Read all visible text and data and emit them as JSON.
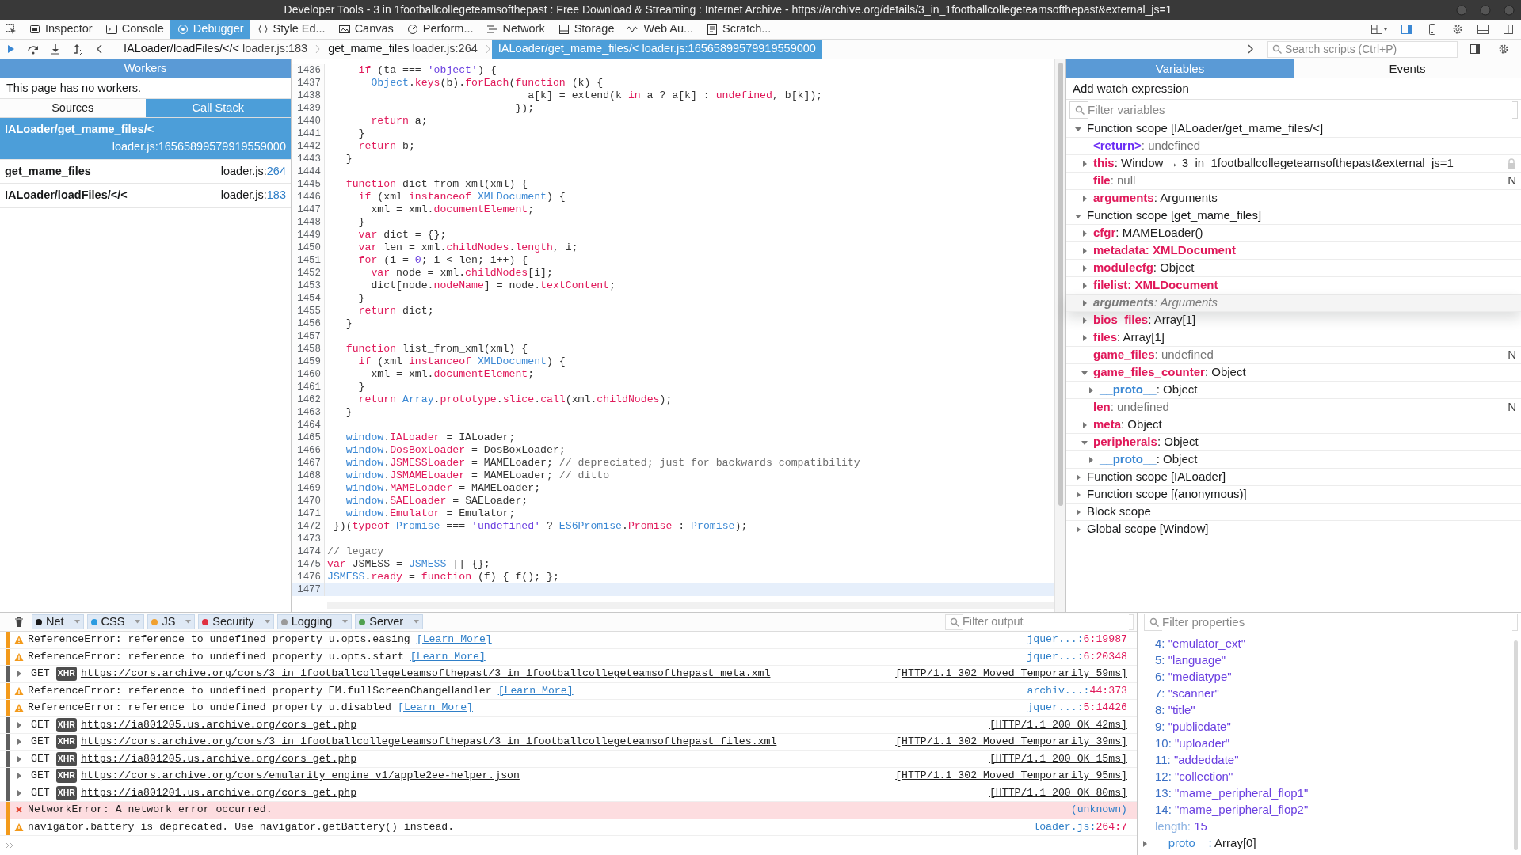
{
  "window": {
    "title": "Developer Tools - 3 in 1footballcollegeteamsofthepast : Free Download & Streaming : Internet Archive - https://archive.org/details/3_in_1footballcollegeteamsofthepast&external_js=1"
  },
  "tabs": [
    {
      "label": "Inspector",
      "selected": false
    },
    {
      "label": "Console",
      "selected": false
    },
    {
      "label": "Debugger",
      "selected": true
    },
    {
      "label": "Style Ed...",
      "selected": false
    },
    {
      "label": "Canvas",
      "selected": false
    },
    {
      "label": "Perform...",
      "selected": false
    },
    {
      "label": "Network",
      "selected": false
    },
    {
      "label": "Storage",
      "selected": false
    },
    {
      "label": "Web Au...",
      "selected": false
    },
    {
      "label": "Scratch...",
      "selected": false
    }
  ],
  "breadcrumbs": [
    {
      "function": "IALoader/loadFiles/</<",
      "location": "loader.js:183",
      "selected": false
    },
    {
      "function": "get_mame_files",
      "location": "loader.js:264",
      "selected": false
    },
    {
      "function": "IALoader/get_mame_files/<",
      "location": "loader.js:16565899579919559000",
      "selected": true
    }
  ],
  "search": {
    "placeholder": "Search scripts (Ctrl+P)"
  },
  "left_panel": {
    "header": "Workers",
    "message": "This page has no workers.",
    "tabs": [
      {
        "label": "Sources",
        "selected": false
      },
      {
        "label": "Call Stack",
        "selected": true
      }
    ],
    "call_stack": [
      {
        "function": "IALoader/get_mame_files/<",
        "file": "loader.js:",
        "line": "16565899579919559000",
        "selected": true
      },
      {
        "function": "get_mame_files",
        "file": "loader.js:",
        "line": "264",
        "selected": false
      },
      {
        "function": "IALoader/loadFiles/</<",
        "file": "loader.js:",
        "line": "183",
        "selected": false
      }
    ]
  },
  "code": [
    {
      "number": "1436",
      "current": false,
      "tokens": [
        {
          "kind": "keyword",
          "text": "     if"
        },
        {
          "kind": "plain",
          "text": " (ta === "
        },
        {
          "kind": "string",
          "text": "'object'"
        },
        {
          "kind": "plain",
          "text": ") {"
        }
      ]
    },
    {
      "number": "1437",
      "current": false,
      "tokens": [
        {
          "kind": "global",
          "text": "       Object"
        },
        {
          "kind": "plain",
          "text": "."
        },
        {
          "kind": "property",
          "text": "keys"
        },
        {
          "kind": "plain",
          "text": "(b)."
        },
        {
          "kind": "property",
          "text": "forEach"
        },
        {
          "kind": "plain",
          "text": "("
        },
        {
          "kind": "keyword",
          "text": "function"
        },
        {
          "kind": "plain",
          "text": " (k) {"
        }
      ]
    },
    {
      "number": "1438",
      "current": false,
      "tokens": [
        {
          "kind": "plain",
          "text": "                                a[k] = extend(k "
        },
        {
          "kind": "keyword",
          "text": "in"
        },
        {
          "kind": "plain",
          "text": " a ? a[k] : "
        },
        {
          "kind": "keyword",
          "text": "undefined"
        },
        {
          "kind": "plain",
          "text": ", b[k]);"
        }
      ]
    },
    {
      "number": "1439",
      "current": false,
      "tokens": [
        {
          "kind": "plain",
          "text": "                              });"
        }
      ]
    },
    {
      "number": "1440",
      "current": false,
      "tokens": [
        {
          "kind": "keyword",
          "text": "       return"
        },
        {
          "kind": "plain",
          "text": " a;"
        }
      ]
    },
    {
      "number": "1441",
      "current": false,
      "tokens": [
        {
          "kind": "plain",
          "text": "     }"
        }
      ]
    },
    {
      "number": "1442",
      "current": false,
      "tokens": [
        {
          "kind": "keyword",
          "text": "     return"
        },
        {
          "kind": "plain",
          "text": " b;"
        }
      ]
    },
    {
      "number": "1443",
      "current": false,
      "tokens": [
        {
          "kind": "plain",
          "text": "   }"
        }
      ]
    },
    {
      "number": "1444",
      "current": false
    },
    {
      "number": "1445",
      "current": false,
      "tokens": [
        {
          "kind": "keyword",
          "text": "   function"
        },
        {
          "kind": "plain",
          "text": " dict_from_xml(xml) {"
        }
      ]
    },
    {
      "number": "1446",
      "current": false,
      "tokens": [
        {
          "kind": "keyword",
          "text": "     if"
        },
        {
          "kind": "plain",
          "text": " (xml "
        },
        {
          "kind": "keyword",
          "text": "instanceof"
        },
        {
          "kind": "global",
          "text": " XMLDocument"
        },
        {
          "kind": "plain",
          "text": ") {"
        }
      ]
    },
    {
      "number": "1447",
      "current": false,
      "tokens": [
        {
          "kind": "plain",
          "text": "       xml = xml."
        },
        {
          "kind": "property",
          "text": "documentElement"
        },
        {
          "kind": "plain",
          "text": ";"
        }
      ]
    },
    {
      "number": "1448",
      "current": false,
      "tokens": [
        {
          "kind": "plain",
          "text": "     }"
        }
      ]
    },
    {
      "number": "1449",
      "current": false,
      "tokens": [
        {
          "kind": "keyword",
          "text": "     var"
        },
        {
          "kind": "plain",
          "text": " dict = {};"
        }
      ]
    },
    {
      "number": "1450",
      "current": false,
      "tokens": [
        {
          "kind": "keyword",
          "text": "     var"
        },
        {
          "kind": "plain",
          "text": " len = xml."
        },
        {
          "kind": "property",
          "text": "childNodes"
        },
        {
          "kind": "plain",
          "text": "."
        },
        {
          "kind": "property",
          "text": "length"
        },
        {
          "kind": "plain",
          "text": ", i;"
        }
      ]
    },
    {
      "number": "1451",
      "current": false,
      "tokens": [
        {
          "kind": "keyword",
          "text": "     for"
        },
        {
          "kind": "plain",
          "text": " (i = "
        },
        {
          "kind": "number",
          "text": "0"
        },
        {
          "kind": "plain",
          "text": "; i < len; i++) {"
        }
      ]
    },
    {
      "number": "1452",
      "current": false,
      "tokens": [
        {
          "kind": "keyword",
          "text": "       var"
        },
        {
          "kind": "plain",
          "text": " node = xml."
        },
        {
          "kind": "property",
          "text": "childNodes"
        },
        {
          "kind": "plain",
          "text": "[i];"
        }
      ]
    },
    {
      "number": "1453",
      "current": false,
      "tokens": [
        {
          "kind": "plain",
          "text": "       dict[node."
        },
        {
          "kind": "property",
          "text": "nodeName"
        },
        {
          "kind": "plain",
          "text": "] = node."
        },
        {
          "kind": "property",
          "text": "textContent"
        },
        {
          "kind": "plain",
          "text": ";"
        }
      ]
    },
    {
      "number": "1454",
      "current": false,
      "tokens": [
        {
          "kind": "plain",
          "text": "     }"
        }
      ]
    },
    {
      "number": "1455",
      "current": false,
      "tokens": [
        {
          "kind": "keyword",
          "text": "     return"
        },
        {
          "kind": "plain",
          "text": " dict;"
        }
      ]
    },
    {
      "number": "1456",
      "current": false,
      "tokens": [
        {
          "kind": "plain",
          "text": "   }"
        }
      ]
    },
    {
      "number": "1457",
      "current": false
    },
    {
      "number": "1458",
      "current": false,
      "tokens": [
        {
          "kind": "keyword",
          "text": "   function"
        },
        {
          "kind": "plain",
          "text": " list_from_xml(xml) {"
        }
      ]
    },
    {
      "number": "1459",
      "current": false,
      "tokens": [
        {
          "kind": "keyword",
          "text": "     if"
        },
        {
          "kind": "plain",
          "text": " (xml "
        },
        {
          "kind": "keyword",
          "text": "instanceof"
        },
        {
          "kind": "global",
          "text": " XMLDocument"
        },
        {
          "kind": "plain",
          "text": ") {"
        }
      ]
    },
    {
      "number": "1460",
      "current": false,
      "tokens": [
        {
          "kind": "plain",
          "text": "       xml = xml."
        },
        {
          "kind": "property",
          "text": "documentElement"
        },
        {
          "kind": "plain",
          "text": ";"
        }
      ]
    },
    {
      "number": "1461",
      "current": false,
      "tokens": [
        {
          "kind": "plain",
          "text": "     }"
        }
      ]
    },
    {
      "number": "1462",
      "current": false,
      "tokens": [
        {
          "kind": "keyword",
          "text": "     return"
        },
        {
          "kind": "global",
          "text": " Array"
        },
        {
          "kind": "plain",
          "text": "."
        },
        {
          "kind": "property",
          "text": "prototype"
        },
        {
          "kind": "plain",
          "text": "."
        },
        {
          "kind": "property",
          "text": "slice"
        },
        {
          "kind": "plain",
          "text": "."
        },
        {
          "kind": "property",
          "text": "call"
        },
        {
          "kind": "plain",
          "text": "(xml."
        },
        {
          "kind": "property",
          "text": "childNodes"
        },
        {
          "kind": "plain",
          "text": ");"
        }
      ]
    },
    {
      "number": "1463",
      "current": false,
      "tokens": [
        {
          "kind": "plain",
          "text": "   }"
        }
      ]
    },
    {
      "number": "1464",
      "current": false
    },
    {
      "number": "1465",
      "current": false,
      "tokens": [
        {
          "kind": "global",
          "text": "   window"
        },
        {
          "kind": "plain",
          "text": "."
        },
        {
          "kind": "property",
          "text": "IALoader"
        },
        {
          "kind": "plain",
          "text": " = IALoader;"
        }
      ]
    },
    {
      "number": "1466",
      "current": false,
      "tokens": [
        {
          "kind": "global",
          "text": "   window"
        },
        {
          "kind": "plain",
          "text": "."
        },
        {
          "kind": "property",
          "text": "DosBoxLoader"
        },
        {
          "kind": "plain",
          "text": " = DosBoxLoader;"
        }
      ]
    },
    {
      "number": "1467",
      "current": false,
      "tokens": [
        {
          "kind": "global",
          "text": "   window"
        },
        {
          "kind": "plain",
          "text": "."
        },
        {
          "kind": "property",
          "text": "JSMESSLoader"
        },
        {
          "kind": "plain",
          "text": " = MAMELoader; "
        },
        {
          "kind": "comment",
          "text": "// depreciated; just for backwards compatibility"
        }
      ]
    },
    {
      "number": "1468",
      "current": false,
      "tokens": [
        {
          "kind": "global",
          "text": "   window"
        },
        {
          "kind": "plain",
          "text": "."
        },
        {
          "kind": "property",
          "text": "JSMAMELoader"
        },
        {
          "kind": "plain",
          "text": " = MAMELoader; "
        },
        {
          "kind": "comment",
          "text": "// ditto"
        }
      ]
    },
    {
      "number": "1469",
      "current": false,
      "tokens": [
        {
          "kind": "global",
          "text": "   window"
        },
        {
          "kind": "plain",
          "text": "."
        },
        {
          "kind": "property",
          "text": "MAMELoader"
        },
        {
          "kind": "plain",
          "text": " = MAMELoader;"
        }
      ]
    },
    {
      "number": "1470",
      "current": false,
      "tokens": [
        {
          "kind": "global",
          "text": "   window"
        },
        {
          "kind": "plain",
          "text": "."
        },
        {
          "kind": "property",
          "text": "SAELoader"
        },
        {
          "kind": "plain",
          "text": " = SAELoader;"
        }
      ]
    },
    {
      "number": "1471",
      "current": false,
      "tokens": [
        {
          "kind": "global",
          "text": "   window"
        },
        {
          "kind": "plain",
          "text": "."
        },
        {
          "kind": "property",
          "text": "Emulator"
        },
        {
          "kind": "plain",
          "text": " = Emulator;"
        }
      ]
    },
    {
      "number": "1472",
      "current": false,
      "tokens": [
        {
          "kind": "plain",
          "text": " })("
        },
        {
          "kind": "keyword",
          "text": "typeof"
        },
        {
          "kind": "global",
          "text": " Promise"
        },
        {
          "kind": "plain",
          "text": " === "
        },
        {
          "kind": "string",
          "text": "'undefined'"
        },
        {
          "kind": "plain",
          "text": " ? "
        },
        {
          "kind": "global",
          "text": "ES6Promise"
        },
        {
          "kind": "plain",
          "text": "."
        },
        {
          "kind": "property",
          "text": "Promise"
        },
        {
          "kind": "plain",
          "text": " : "
        },
        {
          "kind": "global",
          "text": "Promise"
        },
        {
          "kind": "plain",
          "text": ");"
        }
      ]
    },
    {
      "number": "1473",
      "current": false
    },
    {
      "number": "1474",
      "current": false,
      "tokens": [
        {
          "kind": "comment",
          "text": "// legacy"
        }
      ]
    },
    {
      "number": "1475",
      "current": false,
      "tokens": [
        {
          "kind": "keyword",
          "text": "var"
        },
        {
          "kind": "plain",
          "text": " JSMESS = "
        },
        {
          "kind": "global",
          "text": "JSMESS"
        },
        {
          "kind": "plain",
          "text": " || {};"
        }
      ]
    },
    {
      "number": "1476",
      "current": false,
      "tokens": [
        {
          "kind": "global",
          "text": "JSMESS"
        },
        {
          "kind": "plain",
          "text": "."
        },
        {
          "kind": "property",
          "text": "ready"
        },
        {
          "kind": "plain",
          "text": " = "
        },
        {
          "kind": "keyword",
          "text": "function"
        },
        {
          "kind": "plain",
          "text": " (f) { f(); };"
        }
      ]
    },
    {
      "number": "1477",
      "current": true
    }
  ],
  "variables": {
    "tabs": [
      {
        "label": "Variables",
        "selected": true
      },
      {
        "label": "Events",
        "selected": false
      }
    ],
    "watch_label": "Add watch expression",
    "filter_placeholder": "Filter variables",
    "scopes": [
      {
        "label": "Function scope [IALoader/get_mame_files/<]",
        "expanded": true,
        "children": [
          {
            "name": "<return>",
            "value": ": undefined",
            "color": "#6b2cf5",
            "kind": "void",
            "twisty": false,
            "locked": false,
            "shadowed": false
          },
          {
            "name": "this",
            "value": ": Window → 3_in_1footballcollegeteamsofthepast&external_js=1",
            "color": "#e0195a",
            "kind": "text",
            "twisty": true,
            "expanded": false,
            "locked": true,
            "shadowed": false
          },
          {
            "name": "file",
            "value": ": null",
            "color": "#e0195a",
            "kind": "void",
            "twisty": false,
            "locked": false,
            "shadowed": false,
            "flag": "N"
          },
          {
            "name": "arguments",
            "value": ": Arguments",
            "color": "#e0195a",
            "kind": "text",
            "twisty": true,
            "expanded": false,
            "locked": false,
            "shadowed": false
          }
        ]
      },
      {
        "label": "Function scope [get_mame_files]",
        "expanded": true,
        "children": [
          {
            "name": "cfgr",
            "value": ": MAMELoader()",
            "color": "#e0195a",
            "kind": "text",
            "twisty": true,
            "expanded": false,
            "locked": false,
            "shadowed": false
          },
          {
            "name": "metadata",
            "value": ": XMLDocument",
            "color": "#e0195a",
            "kind": "highlight",
            "twisty": true,
            "expanded": false,
            "locked": false,
            "shadowed": false
          },
          {
            "name": "modulecfg",
            "value": ": Object",
            "color": "#e0195a",
            "kind": "text",
            "twisty": true,
            "expanded": false,
            "locked": false,
            "shadowed": false
          },
          {
            "name": "filelist",
            "value": ": XMLDocument",
            "color": "#e0195a",
            "kind": "highlight",
            "twisty": true,
            "expanded": false,
            "locked": false,
            "shadowed": false
          },
          {
            "name": "arguments",
            "value": ": Arguments",
            "color": "#7a7a7a",
            "kind": "text",
            "twisty": true,
            "expanded": false,
            "locked": false,
            "shadowed": true
          },
          {
            "name": "bios_files",
            "value": ": Array[1]",
            "color": "#e0195a",
            "kind": "text",
            "twisty": true,
            "expanded": false,
            "locked": false,
            "shadowed": false
          },
          {
            "name": "files",
            "value": ": Array[1]",
            "color": "#e0195a",
            "kind": "text",
            "twisty": true,
            "expanded": false,
            "locked": false,
            "shadowed": false
          },
          {
            "name": "game_files",
            "value": ": undefined",
            "color": "#e0195a",
            "kind": "void",
            "twisty": false,
            "locked": false,
            "shadowed": false,
            "flag": "N"
          },
          {
            "name": "game_files_counter",
            "value": ": Object",
            "color": "#e0195a",
            "kind": "text",
            "twisty": true,
            "expanded": true,
            "locked": false,
            "shadowed": false,
            "children": [
              {
                "name": "__proto__",
                "value": ": Object",
                "color": "#3b88d4",
                "kind": "text",
                "twisty": true,
                "expanded": false,
                "locked": false,
                "shadowed": false
              }
            ]
          },
          {
            "name": "len",
            "value": ": undefined",
            "color": "#e0195a",
            "kind": "void",
            "twisty": false,
            "locked": false,
            "shadowed": false,
            "flag": "N"
          },
          {
            "name": "meta",
            "value": ": Object",
            "color": "#e0195a",
            "kind": "text",
            "twisty": true,
            "expanded": false,
            "locked": false,
            "shadowed": false
          },
          {
            "name": "peripherals",
            "value": ": Object",
            "color": "#e0195a",
            "kind": "text",
            "twisty": true,
            "expanded": true,
            "locked": false,
            "shadowed": false,
            "children": [
              {
                "name": "__proto__",
                "value": ": Object",
                "color": "#3b88d4",
                "kind": "text",
                "twisty": true,
                "expanded": false,
                "locked": false,
                "shadowed": false
              }
            ]
          }
        ]
      },
      {
        "label": "Function scope [IALoader]",
        "expanded": false
      },
      {
        "label": "Function scope [(anonymous)]",
        "expanded": false
      },
      {
        "label": "Block scope",
        "expanded": false
      },
      {
        "label": "Global scope [Window]",
        "expanded": false
      }
    ]
  },
  "console": {
    "filters": [
      {
        "label": "Net",
        "color": "#1a1a1a",
        "selected": true
      },
      {
        "label": "CSS",
        "color": "#2b9be0",
        "selected": true
      },
      {
        "label": "JS",
        "color": "#f0a030",
        "selected": true
      },
      {
        "label": "Security",
        "color": "#e03040",
        "selected": true
      },
      {
        "label": "Logging",
        "color": "#9a9a9a",
        "selected": true
      },
      {
        "label": "Server",
        "color": "#4fa050",
        "selected": true
      }
    ],
    "filter_placeholder": "Filter output",
    "messages": [
      {
        "kind": "warning",
        "text": "ReferenceError: reference to undefined property u.opts.easing",
        "link": "[Learn More]",
        "source": "jquer...:",
        "position": "6:19987"
      },
      {
        "kind": "warning",
        "text": "ReferenceError: reference to undefined property u.opts.start",
        "link": "[Learn More]",
        "source": "jquer...:",
        "position": "6:20348"
      },
      {
        "kind": "request",
        "method": "GET",
        "badge": "XHR",
        "url": "https://cors.archive.org/cors/3_in_1footballcollegeteamsofthepast/3_in_1footballcollegeteamsofthepast_meta.xml",
        "status": "[HTTP/1.1 302 Moved Temporarily 59ms]",
        "expanded": false
      },
      {
        "kind": "warning",
        "text": "ReferenceError: reference to undefined property EM.fullScreenChangeHandler",
        "link": "[Learn More]",
        "source": "archiv...:",
        "position": "44:373"
      },
      {
        "kind": "warning",
        "text": "ReferenceError: reference to undefined property u.disabled",
        "link": "[Learn More]",
        "source": "jquer...:",
        "position": "5:14426"
      },
      {
        "kind": "request",
        "method": "GET",
        "badge": "XHR",
        "url": "https://ia801205.us.archive.org/cors_get.php",
        "status": "[HTTP/1.1 200 OK 42ms]",
        "expanded": false
      },
      {
        "kind": "request",
        "method": "GET",
        "badge": "XHR",
        "url": "https://cors.archive.org/cors/3_in_1footballcollegeteamsofthepast/3_in_1footballcollegeteamsofthepast_files.xml",
        "status": "[HTTP/1.1 302 Moved Temporarily 39ms]",
        "expanded": false
      },
      {
        "kind": "request",
        "method": "GET",
        "badge": "XHR",
        "url": "https://ia801205.us.archive.org/cors_get.php",
        "status": "[HTTP/1.1 200 OK 15ms]",
        "expanded": false
      },
      {
        "kind": "request",
        "method": "GET",
        "badge": "XHR",
        "url": "https://cors.archive.org/cors/emularity_engine_v1/apple2ee-helper.json",
        "status": "[HTTP/1.1 302 Moved Temporarily 95ms]",
        "expanded": false
      },
      {
        "kind": "request",
        "method": "GET",
        "badge": "XHR",
        "url": "https://ia801201.us.archive.org/cors_get.php",
        "status": "[HTTP/1.1 200 OK 80ms]",
        "expanded": false
      },
      {
        "kind": "error",
        "text": "NetworkError: A network error occurred.",
        "source": "(unknown)"
      },
      {
        "kind": "warning",
        "text": "navigator.battery is deprecated. Use navigator.getBattery() instead.",
        "source": "loader.js:",
        "position": "264:7"
      }
    ]
  },
  "properties": {
    "filter_placeholder": "Filter properties",
    "items": [
      {
        "kind": "index",
        "key": "4:",
        "value": "\"emulator_ext\""
      },
      {
        "kind": "index",
        "key": "5:",
        "value": "\"language\""
      },
      {
        "kind": "index",
        "key": "6:",
        "value": "\"mediatype\""
      },
      {
        "kind": "index",
        "key": "7:",
        "value": "\"scanner\""
      },
      {
        "kind": "index",
        "key": "8:",
        "value": "\"title\""
      },
      {
        "kind": "index",
        "key": "9:",
        "value": "\"publicdate\""
      },
      {
        "kind": "index",
        "key": "10:",
        "value": "\"uploader\""
      },
      {
        "kind": "index",
        "key": "11:",
        "value": "\"addeddate\""
      },
      {
        "kind": "index",
        "key": "12:",
        "value": "\"collection\""
      },
      {
        "kind": "index",
        "key": "13:",
        "value": "\"mame_peripheral_flop1\""
      },
      {
        "kind": "index",
        "key": "14:",
        "value": "\"mame_peripheral_flop2\""
      },
      {
        "kind": "length",
        "key": "length:",
        "value": "15"
      },
      {
        "kind": "proto",
        "key": "__proto__:",
        "value": "Array[0]",
        "expanded": false
      }
    ]
  }
}
